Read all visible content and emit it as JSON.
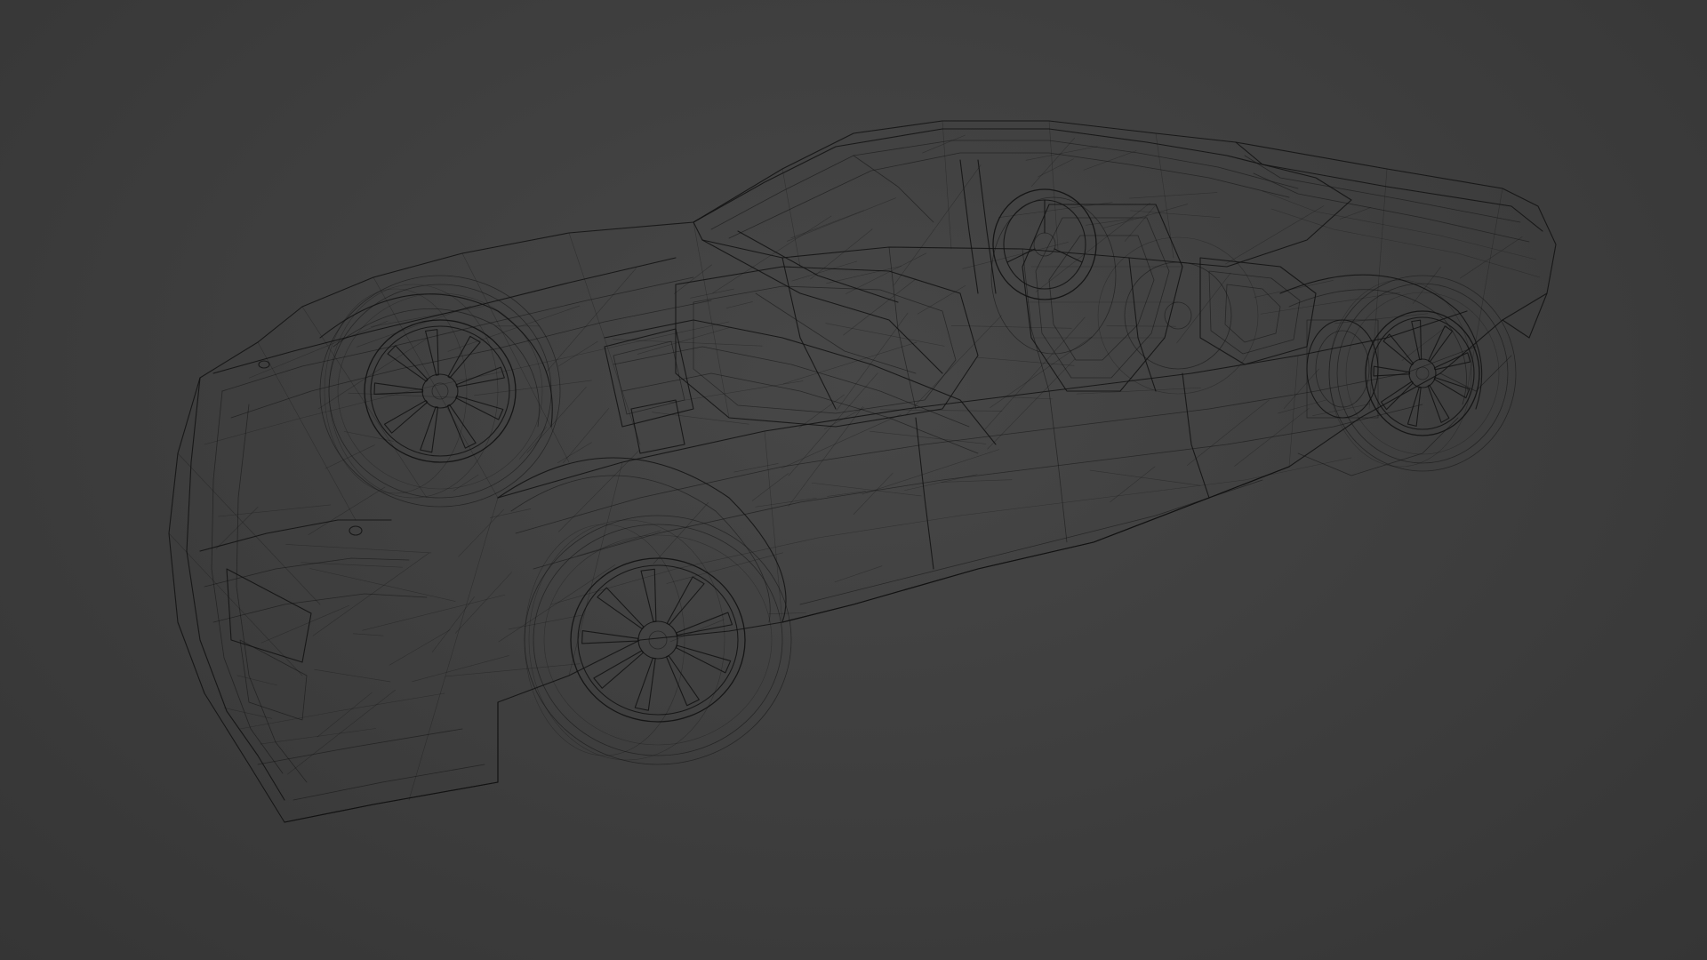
{
  "viewport": {
    "background_color": "#3d3d3d",
    "wire_color": "#121212",
    "shading_mode": "wireframe"
  },
  "model": {
    "subject": "sports-car",
    "wheels": [
      "front-left",
      "front-right",
      "rear-left",
      "rear-right"
    ],
    "spoke_count": 9
  }
}
